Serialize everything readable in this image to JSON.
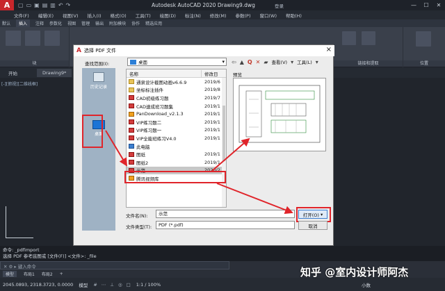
{
  "app": {
    "logo": "A",
    "title": "Autodesk AutoCAD 2020   Drawing9.dwg",
    "signin": "登录",
    "qat_icons": [
      "new-icon",
      "open-icon",
      "save-icon",
      "saveas-icon",
      "print-icon",
      "undo-icon",
      "redo-icon"
    ]
  },
  "menu": [
    "文件(F)",
    "编辑(E)",
    "视图(V)",
    "插入(I)",
    "格式(O)",
    "工具(T)",
    "绘图(D)",
    "标注(N)",
    "修改(M)",
    "参数(P)",
    "窗口(W)",
    "帮助(H)"
  ],
  "ribbon_tabs": [
    "默认",
    "插入",
    "注释",
    "参数化",
    "视图",
    "管理",
    "输出",
    "附加模块",
    "协作",
    "精选应用"
  ],
  "ribbon_active_tab": "插入",
  "ribbon_panels": [
    "块",
    "链接和提取",
    "位置"
  ],
  "file_tabs": [
    "开始",
    "Drawing9*"
  ],
  "drawing": {
    "view_label": "[-][俯视][二维线框]"
  },
  "command": {
    "history": [
      "命令: _pdfimport",
      "选择 PDF 参考底图或 [文件(F)] <文件>: _file"
    ],
    "prompt": "键入命令"
  },
  "layout_tabs": [
    "模型",
    "布局1",
    "布局2"
  ],
  "status": {
    "coords": "2045.0893, 2318.3723, 0.0000",
    "model": "模型",
    "scale": "1:1 / 100%",
    "units": "小数"
  },
  "watermark": "知乎 @室内设计师阿杰",
  "dialog": {
    "title": "选择 PDF 文件",
    "lookin_label": "查找范围(I):",
    "lookin_value": "桌面",
    "view_menu": "查看(V)",
    "tools_menu": "工具(L)",
    "places": [
      "历史记录",
      "桌面"
    ],
    "columns": [
      "名称",
      "修改日"
    ],
    "files": [
      {
        "name": "通泉设计截图动画v6.6.9",
        "date": "2019/6",
        "icon": "folder"
      },
      {
        "name": "坐标标注插件",
        "date": "2019/8",
        "icon": "folder"
      },
      {
        "name": "CAD初级练习题",
        "date": "2019/7",
        "icon": "pdf"
      },
      {
        "name": "CAD速成班习题集",
        "date": "2019/1",
        "icon": "pdf"
      },
      {
        "name": "PanDownload_v2.1.3",
        "date": "2019/1",
        "icon": "app"
      },
      {
        "name": "VIP练习题二",
        "date": "2019/1",
        "icon": "pdf"
      },
      {
        "name": "VIP练习题一",
        "date": "2019/1",
        "icon": "pdf"
      },
      {
        "name": "VIP全能班练习V4.0",
        "date": "2019/1",
        "icon": "pdf"
      },
      {
        "name": "此电脑",
        "date": "",
        "icon": "pc"
      },
      {
        "name": "图纸",
        "date": "2019/1",
        "icon": "pdf"
      },
      {
        "name": "图纸2",
        "date": "2019/1",
        "icon": "pdf"
      },
      {
        "name": "示范",
        "date": "2020/2",
        "icon": "pdf",
        "selected": true
      },
      {
        "name": "腾讯视频库",
        "date": "",
        "icon": "app"
      }
    ],
    "preview_label": "预览",
    "filename_label": "文件名(N):",
    "filename_value": "示范",
    "filetype_label": "文件类型(T):",
    "filetype_value": "PDF (*.pdf)",
    "open_label": "打开(O)",
    "cancel_label": "取消"
  }
}
